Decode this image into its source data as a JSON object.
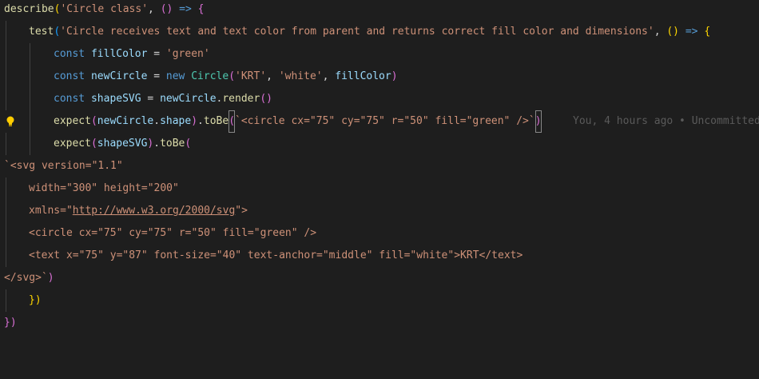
{
  "editor": {
    "blame": "You, 4 hours ago • Uncommitted",
    "lines": [
      [
        {
          "t": "describe",
          "c": "fn"
        },
        {
          "t": "(",
          "c": "b1"
        },
        {
          "t": "'Circle class'",
          "c": "str"
        },
        {
          "t": ", ",
          "c": "pun"
        },
        {
          "t": "()",
          "c": "b2"
        },
        {
          "t": " ",
          "c": "pun"
        },
        {
          "t": "=>",
          "c": "kw"
        },
        {
          "t": " ",
          "c": "pun"
        },
        {
          "t": "{",
          "c": "b2"
        }
      ],
      [
        {
          "t": "test",
          "c": "fn"
        },
        {
          "t": "(",
          "c": "b3"
        },
        {
          "t": "'Circle receives text and text color from parent and returns correct fill color and dimensions'",
          "c": "str"
        },
        {
          "t": ", ",
          "c": "pun"
        },
        {
          "t": "()",
          "c": "b1"
        },
        {
          "t": " ",
          "c": "pun"
        },
        {
          "t": "=>",
          "c": "kw"
        },
        {
          "t": " ",
          "c": "pun"
        },
        {
          "t": "{",
          "c": "b1"
        }
      ],
      [
        {
          "t": "const",
          "c": "kw"
        },
        {
          "t": " ",
          "c": "pun"
        },
        {
          "t": "fillColor",
          "c": "var"
        },
        {
          "t": " = ",
          "c": "pun"
        },
        {
          "t": "'green'",
          "c": "str"
        }
      ],
      [
        {
          "t": "const",
          "c": "kw"
        },
        {
          "t": " ",
          "c": "pun"
        },
        {
          "t": "newCircle",
          "c": "var"
        },
        {
          "t": " = ",
          "c": "pun"
        },
        {
          "t": "new",
          "c": "kw"
        },
        {
          "t": " ",
          "c": "pun"
        },
        {
          "t": "Circle",
          "c": "cls"
        },
        {
          "t": "(",
          "c": "b2"
        },
        {
          "t": "'KRT'",
          "c": "str"
        },
        {
          "t": ", ",
          "c": "pun"
        },
        {
          "t": "'white'",
          "c": "str"
        },
        {
          "t": ", ",
          "c": "pun"
        },
        {
          "t": "fillColor",
          "c": "var"
        },
        {
          "t": ")",
          "c": "b2"
        }
      ],
      [
        {
          "t": "const",
          "c": "kw"
        },
        {
          "t": " ",
          "c": "pun"
        },
        {
          "t": "shapeSVG",
          "c": "var"
        },
        {
          "t": " = ",
          "c": "pun"
        },
        {
          "t": "newCircle",
          "c": "var"
        },
        {
          "t": ".",
          "c": "pun"
        },
        {
          "t": "render",
          "c": "fn"
        },
        {
          "t": "()",
          "c": "b2"
        }
      ],
      [
        {
          "t": "expect",
          "c": "fn"
        },
        {
          "t": "(",
          "c": "b2"
        },
        {
          "t": "newCircle",
          "c": "var"
        },
        {
          "t": ".",
          "c": "pun"
        },
        {
          "t": "shape",
          "c": "var"
        },
        {
          "t": ")",
          "c": "b2"
        },
        {
          "t": ".",
          "c": "pun"
        },
        {
          "t": "toBe",
          "c": "fn"
        },
        {
          "t": "(",
          "c": "b2",
          "box": true
        },
        {
          "t": "`<circle cx=\"75\" cy=\"75\" r=\"50\" fill=\"green\" />`",
          "c": "str"
        },
        {
          "t": ")",
          "c": "b2",
          "box": true
        }
      ],
      [
        {
          "t": "expect",
          "c": "fn"
        },
        {
          "t": "(",
          "c": "b2"
        },
        {
          "t": "shapeSVG",
          "c": "var"
        },
        {
          "t": ")",
          "c": "b2"
        },
        {
          "t": ".",
          "c": "pun"
        },
        {
          "t": "toBe",
          "c": "fn"
        },
        {
          "t": "(",
          "c": "b2"
        }
      ],
      [
        {
          "t": "`<svg version=\"1.1\"",
          "c": "str"
        }
      ],
      [
        {
          "t": "width=\"300\" height=\"200\"",
          "c": "str"
        }
      ],
      [
        {
          "t": "xmlns=\"",
          "c": "str"
        },
        {
          "t": "http://www.w3.org/2000/svg",
          "c": "url"
        },
        {
          "t": "\">",
          "c": "str"
        }
      ],
      [
        {
          "t": "<circle cx=\"75\" cy=\"75\" r=\"50\" fill=\"green\" />",
          "c": "str"
        }
      ],
      [
        {
          "t": "<text x=\"75\" y=\"87\" font-size=\"40\" text-anchor=\"middle\" fill=\"white\">KRT</text>",
          "c": "str"
        }
      ],
      [
        {
          "t": "</svg>`",
          "c": "str"
        },
        {
          "t": ")",
          "c": "b2"
        }
      ],
      [
        {
          "t": "})",
          "c": "b1"
        }
      ],
      [
        {
          "t": "})",
          "c": "b2"
        }
      ]
    ]
  }
}
